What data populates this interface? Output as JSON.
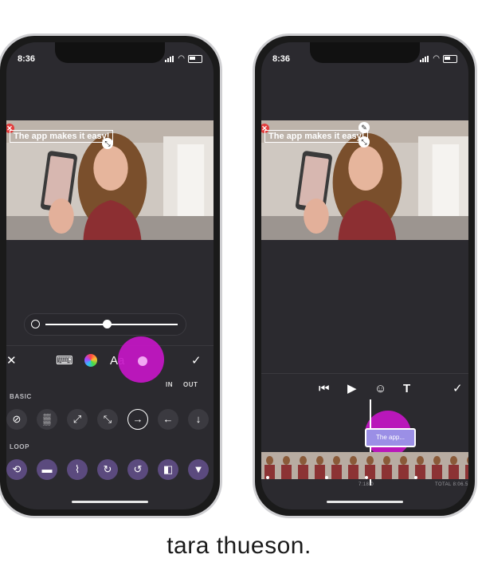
{
  "left_phone": {
    "time": "8:36",
    "caption": "The app makes it easy!",
    "toolbar": {
      "close": "✕",
      "keyboard": "⌨",
      "font_label": "Aa",
      "done": "✓"
    },
    "in_label": "IN",
    "out_label": "OUT",
    "basic_label": "BASIC",
    "loop_label": "LOOP",
    "basic_icons": [
      "⊘",
      "▒",
      "⤢",
      "⤡",
      "→",
      "←",
      "↓"
    ],
    "loop_icons": [
      "⟲",
      "▬",
      "⌇",
      "↻",
      "↺",
      "◧",
      "▼"
    ],
    "accent_color": "#c516c7"
  },
  "right_phone": {
    "time": "8:36",
    "caption": "The app makes it easy!",
    "controls": {
      "skip_back": "⏮",
      "play": "▶",
      "sticker": "☺",
      "text_tool": "T",
      "done": "✓"
    },
    "clip_label": "The app...",
    "timestamp": "7:18.0",
    "total": "TOTAL 8:06.5",
    "clip_color": "#9b8fe6"
  },
  "brand": "tara thueson."
}
